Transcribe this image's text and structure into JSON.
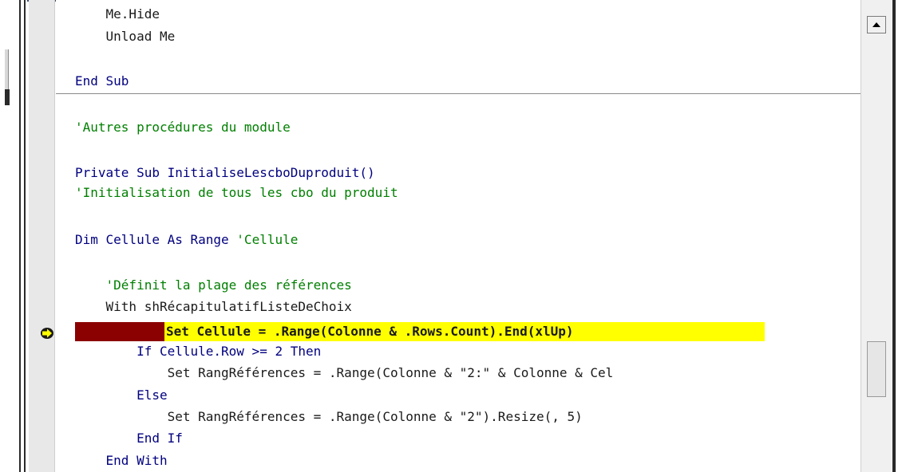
{
  "editor": {
    "lines": [
      {
        "id": "l1",
        "text": "    Me.Hide"
      },
      {
        "id": "l2",
        "text": "    Unload Me"
      },
      {
        "id": "l3",
        "text": "End Sub"
      },
      {
        "id": "l4",
        "text": "'Autres procédures du module"
      },
      {
        "id": "l5",
        "text": "Private Sub InitialiseLescboDuproduit()"
      },
      {
        "id": "l6",
        "text": "'Initialisation de tous les cbo du produit"
      },
      {
        "id": "l7a",
        "text": "Dim Cellule As Range "
      },
      {
        "id": "l7b",
        "text": "'Cellule"
      },
      {
        "id": "l8",
        "text": "    'Définit la plage des références"
      },
      {
        "id": "l9",
        "text": "    With shRécapitulatifListeDeChoix"
      },
      {
        "id": "l10",
        "text": "Set Cellule = .Range(Colonne & .Rows.Count).End(xlUp)"
      },
      {
        "id": "l11",
        "text": "        If Cellule.Row >= 2 Then"
      },
      {
        "id": "l12",
        "text": "            Set RangRéférences = .Range(Colonne & \"2:\" & Colonne & Cel"
      },
      {
        "id": "l13",
        "text": "        Else"
      },
      {
        "id": "l14",
        "text": "            Set RangRéférences = .Range(Colonne & \"2\").Resize(, 5)"
      },
      {
        "id": "l15",
        "text": "        End If"
      },
      {
        "id": "l16",
        "text": "    End With"
      }
    ]
  },
  "colors": {
    "keyword": "#00007f",
    "comment": "#007f00",
    "execution_highlight": "#ffff00",
    "breakpoint": "#8b0000"
  },
  "icons": {
    "execution_pointer": "current-line-arrow-icon",
    "scroll_up": "scroll-up-arrow-icon"
  }
}
